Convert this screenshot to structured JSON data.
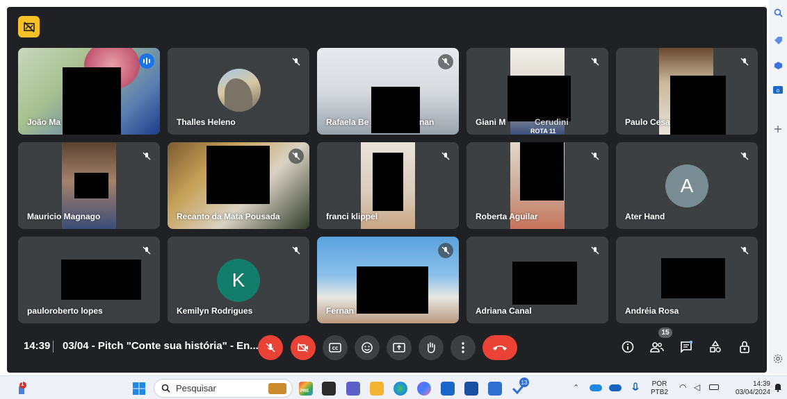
{
  "meeting": {
    "time": "14:39",
    "title": "03/04 - Pitch \"Conte sua história\" - En...",
    "divider": "|"
  },
  "participants": [
    {
      "name": "João Ma",
      "state": "speaking"
    },
    {
      "name": "Thalles Heleno",
      "state": "muted"
    },
    {
      "name": "Rafaela Be",
      "name_tail": "nan",
      "state": "muted"
    },
    {
      "name": "Giani M",
      "name_tail": "Cerudini",
      "state": "muted"
    },
    {
      "name": "Paulo Cesa",
      "state": "muted"
    },
    {
      "name": "Mauricio Magnago",
      "state": "muted"
    },
    {
      "name": "Recanto da Mata Pousada",
      "state": "muted"
    },
    {
      "name": "franci klippel",
      "state": "muted"
    },
    {
      "name": "Roberta Aguilar",
      "state": "muted"
    },
    {
      "name": "Ater Hand",
      "state": "muted",
      "avatar_letter": "A"
    },
    {
      "name": "pauloroberto lopes",
      "state": "muted"
    },
    {
      "name": "Kemilyn Rodrigues",
      "state": "muted",
      "avatar_letter": "K"
    },
    {
      "name": "Fernan",
      "state": "muted"
    },
    {
      "name": "Adriana Canal",
      "state": "muted"
    },
    {
      "name": "Andréia Rosa",
      "state": "muted"
    }
  ],
  "controls": {
    "people_count": "15",
    "video_background_text": "ROTA 11"
  },
  "taskbar": {
    "search_placeholder": "Pesquisar",
    "notification_badge": "1",
    "app_badge": "13",
    "pre_label": "PRE",
    "language_line1": "POR",
    "language_line2": "PTB2",
    "clock_time": "14:39",
    "clock_date": "03/04/2024"
  },
  "colors": {
    "meet_background": "#202124",
    "tile_background": "#3c4043",
    "control_red": "#ea4335",
    "speaking_blue": "#1a73e8",
    "recording_yellow": "#f6c026",
    "avatar_A": "#7a8c94",
    "avatar_K": "#137d6b"
  }
}
